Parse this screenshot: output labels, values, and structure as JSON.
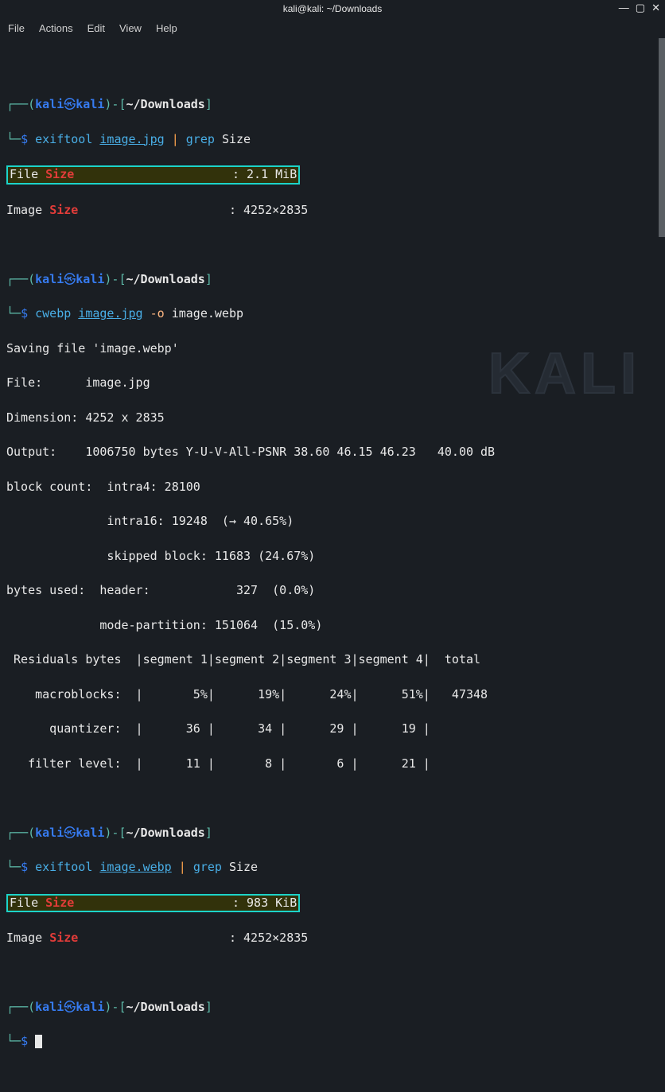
{
  "window": {
    "title": "kali@kali: ~/Downloads"
  },
  "menu": {
    "file": "File",
    "actions": "Actions",
    "edit": "Edit",
    "view": "View",
    "help": "Help"
  },
  "prompt": {
    "user": "kali",
    "host": "kali",
    "path": "~/Downloads",
    "dollar": "$"
  },
  "cmd1": {
    "exe": "exiftool",
    "file": "image.jpg",
    "pipe": "|",
    "grep": "grep",
    "arg": "Size"
  },
  "out1": {
    "file_size_key": "File ",
    "file_size_word": "Size",
    "file_size_sep": "                      : ",
    "file_size_val": "2.1 MiB",
    "image_size_key": "Image ",
    "image_size_word": "Size",
    "image_size_sep": "                     : ",
    "image_size_val": "4252×2835"
  },
  "cmd2": {
    "exe": "cwebp",
    "file": "image.jpg",
    "opt": "-o",
    "out": "image.webp"
  },
  "out2": {
    "l1": "Saving file 'image.webp'",
    "l2": "File:      image.jpg",
    "l3": "Dimension: 4252 x 2835",
    "l4": "Output:    1006750 bytes Y-U-V-All-PSNR 38.60 46.15 46.23   40.00 dB",
    "l5": "block count:  intra4: 28100",
    "l6": "              intra16: 19248  (→ 40.65%)",
    "l7": "              skipped block: 11683 (24.67%)",
    "l8": "bytes used:  header:            327  (0.0%)",
    "l9": "             mode-partition: 151064  (15.0%)",
    "l10": " Residuals bytes  |segment 1|segment 2|segment 3|segment 4|  total",
    "l11": "    macroblocks:  |       5%|      19%|      24%|      51%|   47348",
    "l12": "      quantizer:  |      36 |      34 |      29 |      19 |",
    "l13": "   filter level:  |      11 |       8 |       6 |      21 |"
  },
  "cmd3": {
    "exe": "exiftool",
    "file": "image.webp",
    "pipe": "|",
    "grep": "grep",
    "arg": "Size"
  },
  "out3": {
    "file_size_key": "File ",
    "file_size_word": "Size",
    "file_size_sep": "                      : ",
    "file_size_val": "983 KiB",
    "image_size_key": "Image ",
    "image_size_word": "Size",
    "image_size_sep": "                     : ",
    "image_size_val": "4252×2835"
  },
  "watermark": "KALI"
}
